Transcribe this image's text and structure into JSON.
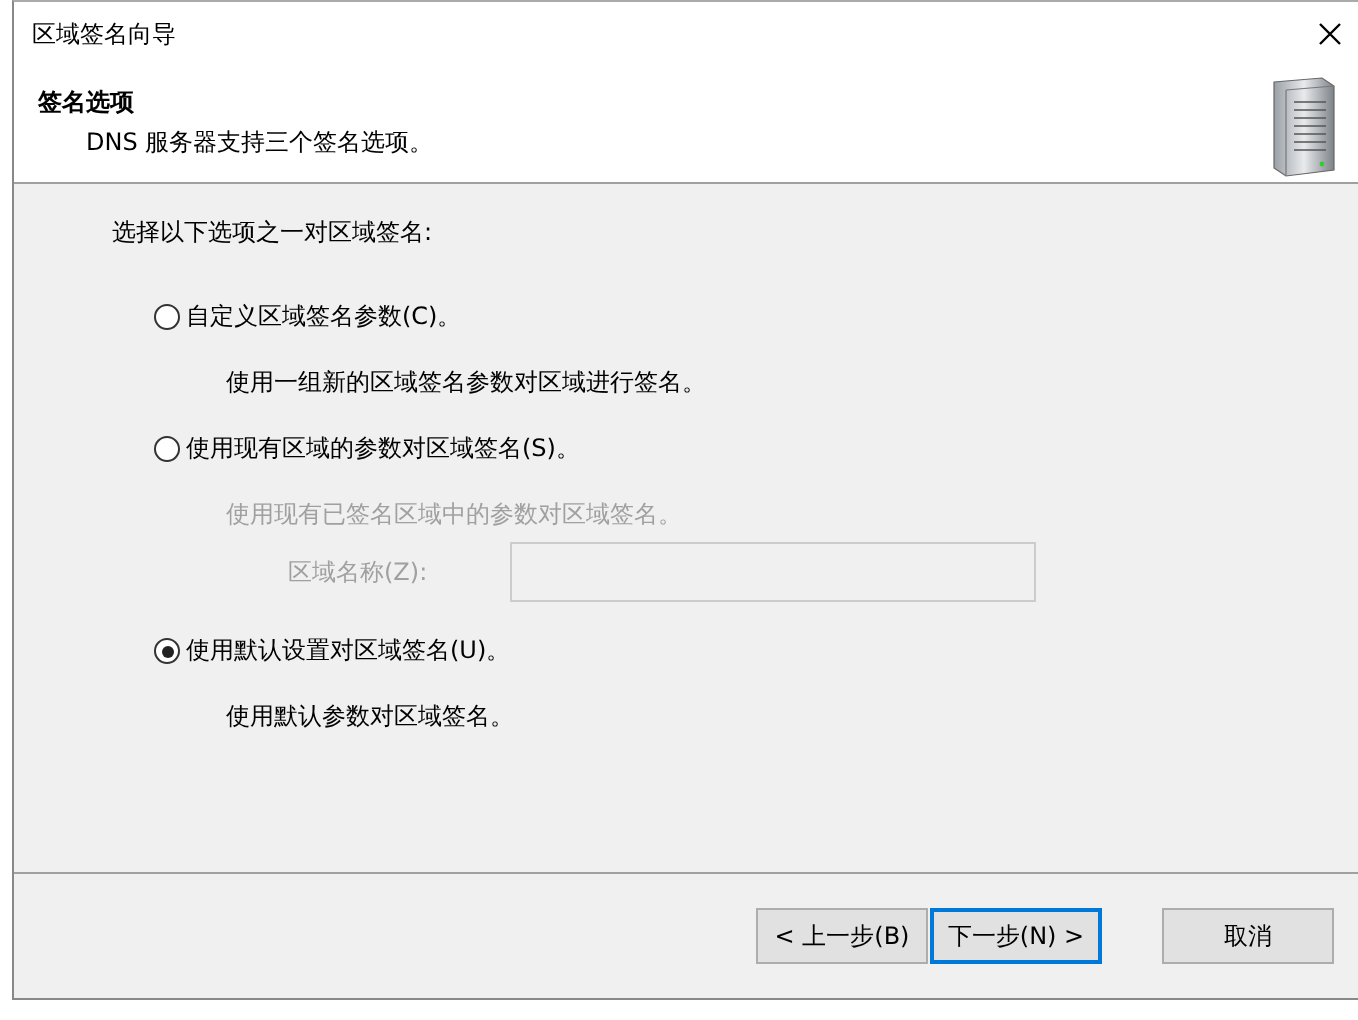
{
  "window": {
    "title": "区域签名向导"
  },
  "header": {
    "title": "签名选项",
    "subtitle": "DNS 服务器支持三个签名选项。"
  },
  "prompt": "选择以下选项之一对区域签名:",
  "options": [
    {
      "label": "自定义区域签名参数(C)。",
      "selected": false,
      "details_disabled": false,
      "description": "使用一组新的区域签名参数对区域进行签名。"
    },
    {
      "label": "使用现有区域的参数对区域签名(S)。",
      "selected": false,
      "details_disabled": true,
      "description": "使用现有已签名区域中的参数对区域签名。",
      "field": {
        "label": "区域名称(Z):"
      }
    },
    {
      "label": "使用默认设置对区域签名(U)。",
      "selected": true,
      "details_disabled": false,
      "description": "使用默认参数对区域签名。"
    }
  ],
  "buttons": [
    {
      "label": "< 上一步(B)",
      "default": false
    },
    {
      "label": "下一步(N) >",
      "default": true
    },
    {
      "label": "取消",
      "default": false
    }
  ]
}
